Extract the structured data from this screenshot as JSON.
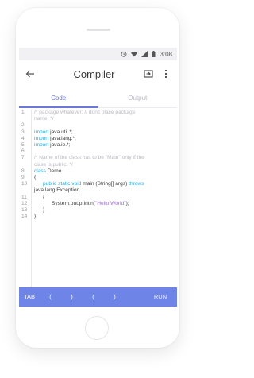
{
  "status_bar": {
    "time": "3:08"
  },
  "app_bar": {
    "title": "Compiler"
  },
  "tabs": [
    {
      "label": "Code",
      "active": true
    },
    {
      "label": "Output",
      "active": false
    }
  ],
  "editor": {
    "lines": [
      {
        "num": "1",
        "segments": [
          {
            "text": "/* package whatever; // don't place package",
            "style": "comment"
          }
        ]
      },
      {
        "num": "",
        "segments": [
          {
            "text": "name! */",
            "style": "comment"
          }
        ]
      },
      {
        "num": "2",
        "segments": [
          {
            "text": "",
            "style": "plain"
          }
        ]
      },
      {
        "num": "3",
        "segments": [
          {
            "text": "import",
            "style": "kw"
          },
          {
            "text": " java.util.*;",
            "style": "plain"
          }
        ]
      },
      {
        "num": "4",
        "segments": [
          {
            "text": "import",
            "style": "kw"
          },
          {
            "text": " java.lang.*;",
            "style": "plain"
          }
        ]
      },
      {
        "num": "5",
        "segments": [
          {
            "text": "import",
            "style": "kw"
          },
          {
            "text": " java.io.*;",
            "style": "plain"
          }
        ]
      },
      {
        "num": "6",
        "segments": [
          {
            "text": "",
            "style": "plain"
          }
        ]
      },
      {
        "num": "7",
        "segments": [
          {
            "text": "/* Name of the class has to be \"Main\" only if the",
            "style": "comment"
          }
        ]
      },
      {
        "num": "",
        "segments": [
          {
            "text": "class is public. */",
            "style": "comment"
          }
        ]
      },
      {
        "num": "8",
        "segments": [
          {
            "text": "class",
            "style": "kw"
          },
          {
            "text": " Demo",
            "style": "plain"
          }
        ]
      },
      {
        "num": "9",
        "segments": [
          {
            "text": "{",
            "style": "plain"
          }
        ]
      },
      {
        "num": "10",
        "segments": [
          {
            "text": "      public static void",
            "style": "kw"
          },
          {
            "text": " main (String[] args) ",
            "style": "plain"
          },
          {
            "text": "throws",
            "style": "kw"
          }
        ]
      },
      {
        "num": "",
        "segments": [
          {
            "text": "java.lang.Exception",
            "style": "plain"
          }
        ]
      },
      {
        "num": "11",
        "segments": [
          {
            "text": "      {",
            "style": "plain"
          }
        ]
      },
      {
        "num": "12",
        "segments": [
          {
            "text": "            System.out.println(",
            "style": "plain"
          },
          {
            "text": "\"Hello World\"",
            "style": "str"
          },
          {
            "text": ");",
            "style": "plain"
          }
        ]
      },
      {
        "num": "13",
        "segments": [
          {
            "text": "      }",
            "style": "plain"
          }
        ]
      },
      {
        "num": "14",
        "segments": [
          {
            "text": "}",
            "style": "plain"
          }
        ]
      }
    ]
  },
  "toolbar": {
    "tab_label": "TAB",
    "keys": [
      "(",
      ")",
      "(",
      ")"
    ],
    "run_label": "RUN"
  },
  "colors": {
    "accent": "#6e84e6",
    "tab_active": "#6a78d9",
    "keyword": "#2aa8d8",
    "string": "#a06bd8",
    "comment": "#b9b9c3"
  },
  "icons": [
    "wifi-icon",
    "signal-icon",
    "battery-icon",
    "back-arrow-icon",
    "run-export-icon",
    "more-vert-icon"
  ]
}
